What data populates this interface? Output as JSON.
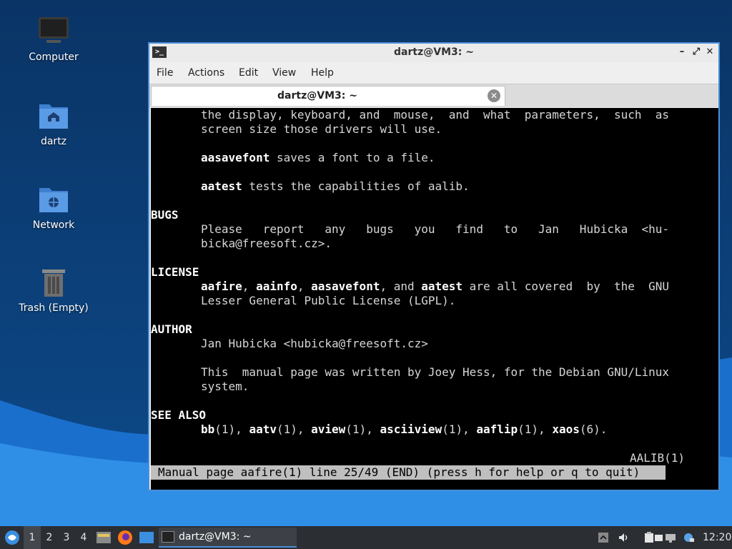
{
  "desktop": {
    "icons": [
      {
        "label": "Computer"
      },
      {
        "label": "dartz"
      },
      {
        "label": "Network"
      },
      {
        "label": "Trash (Empty)"
      }
    ]
  },
  "window": {
    "title": "dartz@VM3: ~",
    "menu": [
      "File",
      "Actions",
      "Edit",
      "View",
      "Help"
    ],
    "tab_label": "dartz@VM3: ~"
  },
  "terminal": {
    "line_01": "the display, keyboard, and  mouse,  and  what  parameters,  such  as",
    "line_02": "screen size those drivers will use.",
    "line_03_cmd": "aasavefont",
    "line_03_text": " saves a font to a file.",
    "line_04_cmd": "aatest",
    "line_04_text": " tests the capabilities of aalib.",
    "section_bugs": "BUGS",
    "line_05": "Please   report   any   bugs   you   find   to   Jan   Hubicka  <hu-",
    "line_06": "bicka@freesoft.cz>.",
    "section_license": "LICENSE",
    "line_07_a": "aafire",
    "line_07_b": ", ",
    "line_07_c": "aainfo",
    "line_07_d": ", ",
    "line_07_e": "aasavefont",
    "line_07_f": ", and ",
    "line_07_g": "aatest",
    "line_07_h": " are all covered  by  the  GNU",
    "line_08": "Lesser General Public License (LGPL).",
    "section_author": "AUTHOR",
    "line_09": "Jan Hubicka <hubicka@freesoft.cz>",
    "line_10": "This  manual page was written by Joey Hess, for the Debian GNU/Linux",
    "line_11": "system.",
    "section_see_also": "SEE ALSO",
    "see_also": [
      {
        "name": "bb",
        "sect": "(1), "
      },
      {
        "name": "aatv",
        "sect": "(1), "
      },
      {
        "name": "aview",
        "sect": "(1), "
      },
      {
        "name": "asciiview",
        "sect": "(1), "
      },
      {
        "name": "aaflip",
        "sect": "(1), "
      },
      {
        "name": "xaos",
        "sect": "(6)."
      }
    ],
    "footer_right": "AALIB(1)",
    "status": "Manual page aafire(1) line 25/49 (END) (press h for help or q to quit)"
  },
  "taskbar": {
    "workspaces": [
      "1",
      "2",
      "3",
      "4"
    ],
    "active_workspace": "1",
    "task_label": "dartz@VM3: ~",
    "clock": "12:20"
  },
  "colors": {
    "accent": "#4a8ed6",
    "desktop_bg": "#0b3a6e",
    "terminal_bg": "#000000"
  }
}
